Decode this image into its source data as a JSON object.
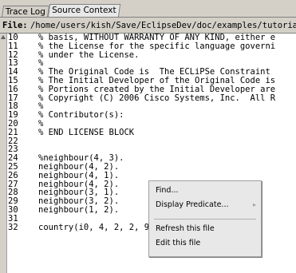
{
  "tabs": [
    {
      "label": "Trace Log"
    },
    {
      "label": "Source Context"
    }
  ],
  "file": {
    "label": "File:",
    "path": "/home/users/kish/Save/EclipseDev/doc/examples/tutorial/"
  },
  "lines": [
    {
      "num": "10",
      "code": "% basis, WITHOUT WARRANTY OF ANY KIND, either e"
    },
    {
      "num": "11",
      "code": "% the License for the specific language governi"
    },
    {
      "num": "12",
      "code": "% under the License."
    },
    {
      "num": "13",
      "code": "%"
    },
    {
      "num": "14",
      "code": "% The Original Code is  The ECLiPSe Constraint"
    },
    {
      "num": "15",
      "code": "% The Initial Developer of the Original Code is"
    },
    {
      "num": "16",
      "code": "% Portions created by the Initial Developer are"
    },
    {
      "num": "17",
      "code": "% Copyright (C) 2006 Cisco Systems, Inc.  All R"
    },
    {
      "num": "18",
      "code": "%"
    },
    {
      "num": "19",
      "code": "% Contributor(s):"
    },
    {
      "num": "20",
      "code": "%"
    },
    {
      "num": "21",
      "code": "% END LICENSE BLOCK"
    },
    {
      "num": "22",
      "code": ""
    },
    {
      "num": "23",
      "code": ""
    },
    {
      "num": "24",
      "code": "%neighbour(4, 3)."
    },
    {
      "num": "25",
      "code": "neighbour(4, 2)."
    },
    {
      "num": "26",
      "code": "neighbour(4, 1)."
    },
    {
      "num": "27",
      "code": "neighbour(4, 2)."
    },
    {
      "num": "28",
      "code": "neighbour(3, 1)."
    },
    {
      "num": "29",
      "code": "neighbour(3, 2)."
    },
    {
      "num": "30",
      "code": "neighbour(1, 2)."
    },
    {
      "num": "31",
      "code": ""
    },
    {
      "num": "32",
      "code": "country(i0, 4, 2, 2, 9, 12)."
    }
  ],
  "context_menu": {
    "find": "Find...",
    "display_predicate": "Display Predicate...",
    "refresh": "Refresh this file",
    "edit": "Edit this file"
  }
}
